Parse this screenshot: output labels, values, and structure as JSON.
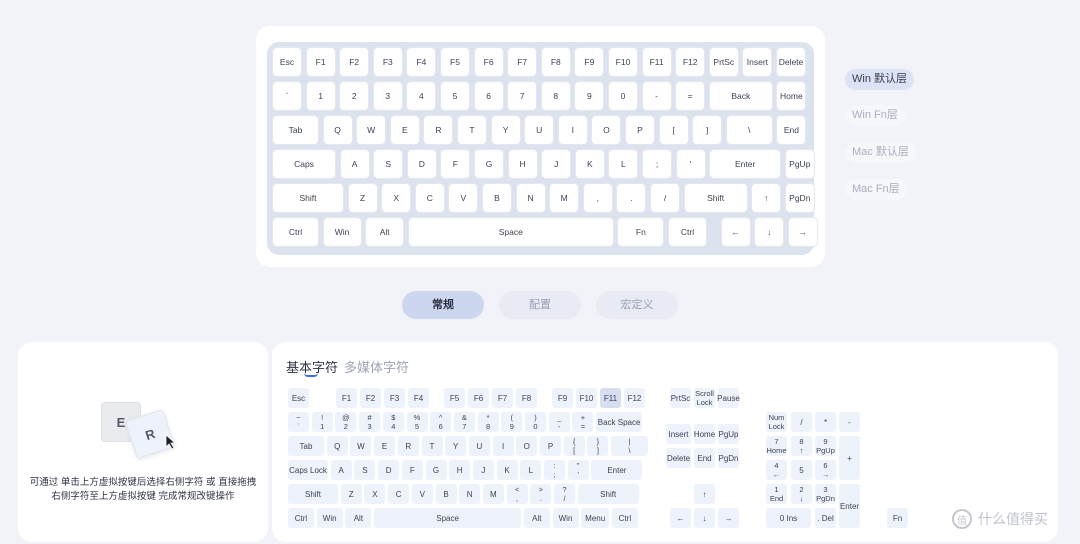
{
  "main_keyboard": {
    "rows": [
      [
        "Esc",
        "F1",
        "F2",
        "F3",
        "F4",
        "F5",
        "F6",
        "F7",
        "F8",
        "F9",
        "F10",
        "F11",
        "F12",
        "PrtSc",
        "Insert",
        "Delete"
      ],
      [
        "`",
        "1",
        "2",
        "3",
        "4",
        "5",
        "6",
        "7",
        "8",
        "9",
        "0",
        "-",
        "=",
        "Back",
        "Home"
      ],
      [
        "Tab",
        "Q",
        "W",
        "E",
        "R",
        "T",
        "Y",
        "U",
        "I",
        "O",
        "P",
        "[",
        "]",
        "\\",
        "End"
      ],
      [
        "Caps",
        "A",
        "S",
        "D",
        "F",
        "G",
        "H",
        "J",
        "K",
        "L",
        ";",
        "'",
        "Enter",
        "PgUp"
      ],
      [
        "Shift",
        "Z",
        "X",
        "C",
        "V",
        "B",
        "N",
        "M",
        ",",
        ".",
        "/",
        "Shift",
        "↑",
        "PgDn"
      ],
      [
        "Ctrl",
        "Win",
        "Alt",
        "Space",
        "Fn",
        "Ctrl",
        "←",
        "↓",
        "→"
      ]
    ]
  },
  "layers": [
    "Win 默认层",
    "Win Fn层",
    "Mac 默认层",
    "Mac Fn层"
  ],
  "tabs": [
    "常规",
    "配置",
    "宏定义"
  ],
  "hint": {
    "key_e": "E",
    "key_r": "R",
    "line1": "可通过 单击上方虚拟按键后选择右侧字符 或 直接拖拽",
    "line2": "右侧字符至上方虚拟按键 完成常规改键操作"
  },
  "virtual_keyboard": {
    "tabs": [
      "基本字符",
      "多媒体字符"
    ],
    "main_keys": [
      [
        "Esc",
        "F1",
        "F2",
        "F3",
        "F4",
        "F5",
        "F6",
        "F7",
        "F8",
        "F9",
        "F10",
        "F11",
        "F12"
      ],
      [
        [
          "~",
          "`"
        ],
        [
          "!",
          "1"
        ],
        [
          "@",
          "2"
        ],
        [
          "#",
          "3"
        ],
        [
          "$",
          "4"
        ],
        [
          "%",
          "5"
        ],
        [
          "^",
          "6"
        ],
        [
          "&",
          "7"
        ],
        [
          "*",
          "8"
        ],
        [
          "(",
          "9"
        ],
        [
          ")",
          "0"
        ],
        [
          "_",
          "-"
        ],
        [
          "+",
          "="
        ],
        "Back Space"
      ],
      [
        "Tab",
        "Q",
        "W",
        "E",
        "R",
        "T",
        "Y",
        "U",
        "I",
        "O",
        "P",
        [
          "{",
          "["
        ],
        [
          "}",
          "]"
        ],
        [
          "|",
          "\\"
        ]
      ],
      [
        "Caps Lock",
        "A",
        "S",
        "D",
        "F",
        "G",
        "H",
        "J",
        "K",
        "L",
        [
          ":",
          ";"
        ],
        [
          "\"",
          "'"
        ],
        "Enter"
      ],
      [
        "Shift",
        "Z",
        "X",
        "C",
        "V",
        "B",
        "N",
        "M",
        [
          "<",
          ","
        ],
        [
          ">",
          "."
        ],
        [
          "?",
          "/"
        ],
        "Shift"
      ],
      [
        "Ctrl",
        "Win",
        "Alt",
        "Space",
        "Alt",
        "Win",
        "Menu",
        "Ctrl"
      ]
    ],
    "nav_keys": {
      "top": [
        "PrtSc",
        [
          "Scroll",
          "Lock"
        ],
        "Pause"
      ],
      "mid1": [
        "Insert",
        "Home",
        "PgUp"
      ],
      "mid2": [
        "Delete",
        "End",
        "PgDn"
      ],
      "up": "↑",
      "arrows": [
        "←",
        "↓",
        "→"
      ]
    },
    "numpad": {
      "row0": [
        [
          "Num",
          "Lock"
        ],
        "/",
        "*",
        "-"
      ],
      "row1": [
        [
          "7",
          "Home"
        ],
        [
          "8",
          "↑"
        ],
        [
          "9",
          "PgUp"
        ]
      ],
      "plus": "+",
      "row2": [
        [
          "4",
          "←"
        ],
        "5",
        [
          "6",
          "→"
        ]
      ],
      "row3": [
        [
          "1",
          "End"
        ],
        [
          "2",
          "↓"
        ],
        [
          "3",
          "PgDn"
        ]
      ],
      "enter": "Enter",
      "zero": "0 Ins",
      "del": ". Del"
    },
    "fn": "Fn"
  },
  "watermark": "什么值得买",
  "colors": {
    "accent": "#3b6ef5",
    "active_tab": "#ccd6ef",
    "key_fill": "#eef2fb"
  }
}
